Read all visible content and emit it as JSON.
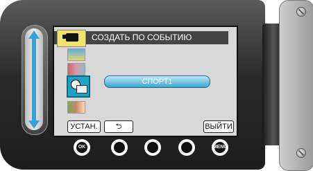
{
  "screen": {
    "title": "СОЗДАТЬ ПО СОБЫТИЮ",
    "selected_option": "СПОРТ1",
    "icons": [
      "beach-icon",
      "party-icon",
      "sports-icon",
      "travel-icon"
    ]
  },
  "bottom_buttons": {
    "set_label": "УСТАН.",
    "exit_label": "ВЫЙТИ"
  },
  "hardware_buttons": {
    "ok_label": "OK",
    "menu_label": "MENU"
  },
  "colors": {
    "accent": "#3aa0d8",
    "title_bar": "#444444",
    "screen_bg": "#d8d8d8"
  }
}
